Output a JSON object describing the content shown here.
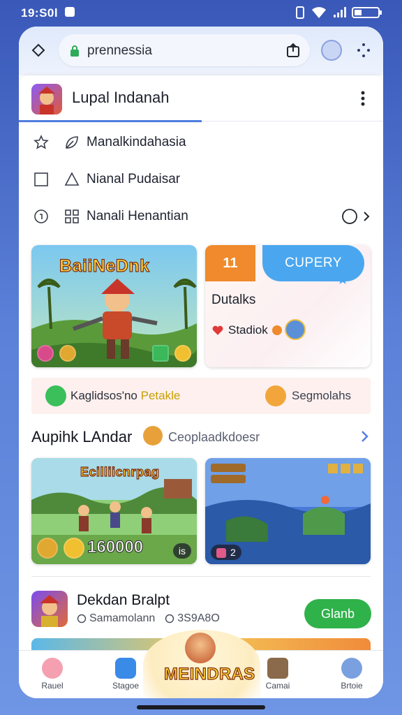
{
  "status_bar": {
    "time": "19:S0l"
  },
  "browser": {
    "url": "prennessia"
  },
  "page": {
    "title": "Lupal Indanah"
  },
  "menu": [
    {
      "label": "Manalkindahasia"
    },
    {
      "label": "Nianal Pudaisar"
    },
    {
      "label": "Nanali Henantian"
    }
  ],
  "hero_card": {
    "logo": "BaiiNeDnk"
  },
  "deal_card": {
    "number": "11",
    "pill": "CUPERY",
    "title": "Dutalks",
    "tag": "Stadiok"
  },
  "strip": {
    "text_main": "Kaglidsos'no",
    "text_highlight": "Petakle",
    "text_right": "Segmolahs"
  },
  "section": {
    "title": "Aupihk LAndar",
    "subtitle": "Ceoplaadkdoesr"
  },
  "game_left": {
    "logo": "Ecilliicnrpag",
    "stat": "160000",
    "pill": "is"
  },
  "game_right": {
    "pill": "2"
  },
  "listing": {
    "title": "Dekdan Bralpt",
    "meta_a": "Samamolann",
    "meta_b": "3S9A8O",
    "button": "Glanb"
  },
  "nav": {
    "items": [
      {
        "label": "Rauel"
      },
      {
        "label": "Stagoe"
      },
      {
        "label": "Camai"
      },
      {
        "label": "Brtoie"
      }
    ],
    "center": "MEINDRAS"
  },
  "colors": {
    "accent": "#4f7de0",
    "cta": "#2fb24a",
    "orange": "#f08a2c",
    "blue_pill": "#4aa7ef"
  }
}
